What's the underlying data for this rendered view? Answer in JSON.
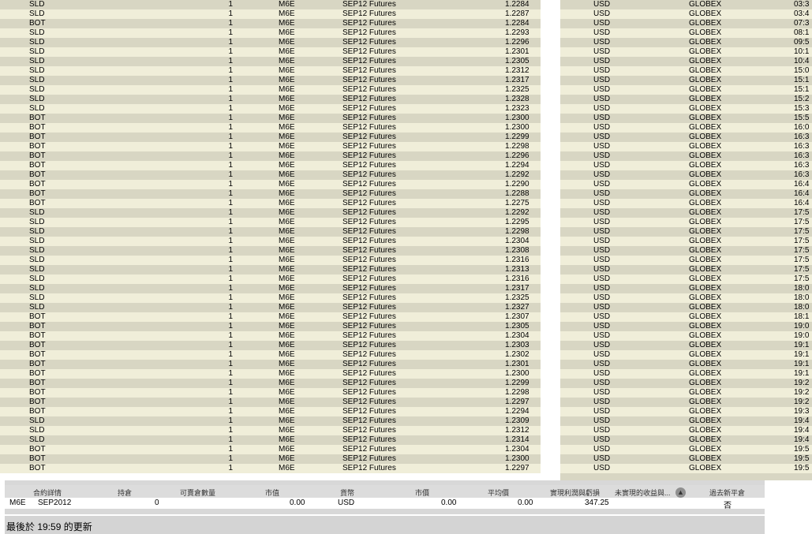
{
  "trades": [
    {
      "action": "SLD",
      "qty": "1",
      "symbol": "M6E",
      "description": "SEP12 Futures",
      "price": "1.2284",
      "currency": "USD",
      "exchange": "GLOBEX",
      "time": "03:3"
    },
    {
      "action": "SLD",
      "qty": "1",
      "symbol": "M6E",
      "description": "SEP12 Futures",
      "price": "1.2287",
      "currency": "USD",
      "exchange": "GLOBEX",
      "time": "03:4"
    },
    {
      "action": "BOT",
      "qty": "1",
      "symbol": "M6E",
      "description": "SEP12 Futures",
      "price": "1.2284",
      "currency": "USD",
      "exchange": "GLOBEX",
      "time": "07:3"
    },
    {
      "action": "SLD",
      "qty": "1",
      "symbol": "M6E",
      "description": "SEP12 Futures",
      "price": "1.2293",
      "currency": "USD",
      "exchange": "GLOBEX",
      "time": "08:1"
    },
    {
      "action": "SLD",
      "qty": "1",
      "symbol": "M6E",
      "description": "SEP12 Futures",
      "price": "1.2296",
      "currency": "USD",
      "exchange": "GLOBEX",
      "time": "09:5"
    },
    {
      "action": "SLD",
      "qty": "1",
      "symbol": "M6E",
      "description": "SEP12 Futures",
      "price": "1.2301",
      "currency": "USD",
      "exchange": "GLOBEX",
      "time": "10:1"
    },
    {
      "action": "SLD",
      "qty": "1",
      "symbol": "M6E",
      "description": "SEP12 Futures",
      "price": "1.2305",
      "currency": "USD",
      "exchange": "GLOBEX",
      "time": "10:4"
    },
    {
      "action": "SLD",
      "qty": "1",
      "symbol": "M6E",
      "description": "SEP12 Futures",
      "price": "1.2312",
      "currency": "USD",
      "exchange": "GLOBEX",
      "time": "15:0"
    },
    {
      "action": "SLD",
      "qty": "1",
      "symbol": "M6E",
      "description": "SEP12 Futures",
      "price": "1.2317",
      "currency": "USD",
      "exchange": "GLOBEX",
      "time": "15:1"
    },
    {
      "action": "SLD",
      "qty": "1",
      "symbol": "M6E",
      "description": "SEP12 Futures",
      "price": "1.2325",
      "currency": "USD",
      "exchange": "GLOBEX",
      "time": "15:1"
    },
    {
      "action": "SLD",
      "qty": "1",
      "symbol": "M6E",
      "description": "SEP12 Futures",
      "price": "1.2328",
      "currency": "USD",
      "exchange": "GLOBEX",
      "time": "15:2"
    },
    {
      "action": "SLD",
      "qty": "1",
      "symbol": "M6E",
      "description": "SEP12 Futures",
      "price": "1.2323",
      "currency": "USD",
      "exchange": "GLOBEX",
      "time": "15:3"
    },
    {
      "action": "BOT",
      "qty": "1",
      "symbol": "M6E",
      "description": "SEP12 Futures",
      "price": "1.2300",
      "currency": "USD",
      "exchange": "GLOBEX",
      "time": "15:5"
    },
    {
      "action": "BOT",
      "qty": "1",
      "symbol": "M6E",
      "description": "SEP12 Futures",
      "price": "1.2300",
      "currency": "USD",
      "exchange": "GLOBEX",
      "time": "16:0"
    },
    {
      "action": "BOT",
      "qty": "1",
      "symbol": "M6E",
      "description": "SEP12 Futures",
      "price": "1.2299",
      "currency": "USD",
      "exchange": "GLOBEX",
      "time": "16:3"
    },
    {
      "action": "BOT",
      "qty": "1",
      "symbol": "M6E",
      "description": "SEP12 Futures",
      "price": "1.2298",
      "currency": "USD",
      "exchange": "GLOBEX",
      "time": "16:3"
    },
    {
      "action": "BOT",
      "qty": "1",
      "symbol": "M6E",
      "description": "SEP12 Futures",
      "price": "1.2296",
      "currency": "USD",
      "exchange": "GLOBEX",
      "time": "16:3"
    },
    {
      "action": "BOT",
      "qty": "1",
      "symbol": "M6E",
      "description": "SEP12 Futures",
      "price": "1.2294",
      "currency": "USD",
      "exchange": "GLOBEX",
      "time": "16:3"
    },
    {
      "action": "BOT",
      "qty": "1",
      "symbol": "M6E",
      "description": "SEP12 Futures",
      "price": "1.2292",
      "currency": "USD",
      "exchange": "GLOBEX",
      "time": "16:3"
    },
    {
      "action": "BOT",
      "qty": "1",
      "symbol": "M6E",
      "description": "SEP12 Futures",
      "price": "1.2290",
      "currency": "USD",
      "exchange": "GLOBEX",
      "time": "16:4"
    },
    {
      "action": "BOT",
      "qty": "1",
      "symbol": "M6E",
      "description": "SEP12 Futures",
      "price": "1.2288",
      "currency": "USD",
      "exchange": "GLOBEX",
      "time": "16:4"
    },
    {
      "action": "BOT",
      "qty": "1",
      "symbol": "M6E",
      "description": "SEP12 Futures",
      "price": "1.2275",
      "currency": "USD",
      "exchange": "GLOBEX",
      "time": "16:4"
    },
    {
      "action": "SLD",
      "qty": "1",
      "symbol": "M6E",
      "description": "SEP12 Futures",
      "price": "1.2292",
      "currency": "USD",
      "exchange": "GLOBEX",
      "time": "17:5"
    },
    {
      "action": "SLD",
      "qty": "1",
      "symbol": "M6E",
      "description": "SEP12 Futures",
      "price": "1.2295",
      "currency": "USD",
      "exchange": "GLOBEX",
      "time": "17:5"
    },
    {
      "action": "SLD",
      "qty": "1",
      "symbol": "M6E",
      "description": "SEP12 Futures",
      "price": "1.2298",
      "currency": "USD",
      "exchange": "GLOBEX",
      "time": "17:5"
    },
    {
      "action": "SLD",
      "qty": "1",
      "symbol": "M6E",
      "description": "SEP12 Futures",
      "price": "1.2304",
      "currency": "USD",
      "exchange": "GLOBEX",
      "time": "17:5"
    },
    {
      "action": "SLD",
      "qty": "1",
      "symbol": "M6E",
      "description": "SEP12 Futures",
      "price": "1.2308",
      "currency": "USD",
      "exchange": "GLOBEX",
      "time": "17:5"
    },
    {
      "action": "SLD",
      "qty": "1",
      "symbol": "M6E",
      "description": "SEP12 Futures",
      "price": "1.2316",
      "currency": "USD",
      "exchange": "GLOBEX",
      "time": "17:5"
    },
    {
      "action": "SLD",
      "qty": "1",
      "symbol": "M6E",
      "description": "SEP12 Futures",
      "price": "1.2313",
      "currency": "USD",
      "exchange": "GLOBEX",
      "time": "17:5"
    },
    {
      "action": "SLD",
      "qty": "1",
      "symbol": "M6E",
      "description": "SEP12 Futures",
      "price": "1.2316",
      "currency": "USD",
      "exchange": "GLOBEX",
      "time": "17:5"
    },
    {
      "action": "SLD",
      "qty": "1",
      "symbol": "M6E",
      "description": "SEP12 Futures",
      "price": "1.2317",
      "currency": "USD",
      "exchange": "GLOBEX",
      "time": "18:0"
    },
    {
      "action": "SLD",
      "qty": "1",
      "symbol": "M6E",
      "description": "SEP12 Futures",
      "price": "1.2325",
      "currency": "USD",
      "exchange": "GLOBEX",
      "time": "18:0"
    },
    {
      "action": "SLD",
      "qty": "1",
      "symbol": "M6E",
      "description": "SEP12 Futures",
      "price": "1.2327",
      "currency": "USD",
      "exchange": "GLOBEX",
      "time": "18:0"
    },
    {
      "action": "BOT",
      "qty": "1",
      "symbol": "M6E",
      "description": "SEP12 Futures",
      "price": "1.2307",
      "currency": "USD",
      "exchange": "GLOBEX",
      "time": "18:1"
    },
    {
      "action": "BOT",
      "qty": "1",
      "symbol": "M6E",
      "description": "SEP12 Futures",
      "price": "1.2305",
      "currency": "USD",
      "exchange": "GLOBEX",
      "time": "19:0"
    },
    {
      "action": "BOT",
      "qty": "1",
      "symbol": "M6E",
      "description": "SEP12 Futures",
      "price": "1.2304",
      "currency": "USD",
      "exchange": "GLOBEX",
      "time": "19:0"
    },
    {
      "action": "BOT",
      "qty": "1",
      "symbol": "M6E",
      "description": "SEP12 Futures",
      "price": "1.2303",
      "currency": "USD",
      "exchange": "GLOBEX",
      "time": "19:1"
    },
    {
      "action": "BOT",
      "qty": "1",
      "symbol": "M6E",
      "description": "SEP12 Futures",
      "price": "1.2302",
      "currency": "USD",
      "exchange": "GLOBEX",
      "time": "19:1"
    },
    {
      "action": "BOT",
      "qty": "1",
      "symbol": "M6E",
      "description": "SEP12 Futures",
      "price": "1.2301",
      "currency": "USD",
      "exchange": "GLOBEX",
      "time": "19:1"
    },
    {
      "action": "BOT",
      "qty": "1",
      "symbol": "M6E",
      "description": "SEP12 Futures",
      "price": "1.2300",
      "currency": "USD",
      "exchange": "GLOBEX",
      "time": "19:1"
    },
    {
      "action": "BOT",
      "qty": "1",
      "symbol": "M6E",
      "description": "SEP12 Futures",
      "price": "1.2299",
      "currency": "USD",
      "exchange": "GLOBEX",
      "time": "19:2"
    },
    {
      "action": "BOT",
      "qty": "1",
      "symbol": "M6E",
      "description": "SEP12 Futures",
      "price": "1.2298",
      "currency": "USD",
      "exchange": "GLOBEX",
      "time": "19:2"
    },
    {
      "action": "BOT",
      "qty": "1",
      "symbol": "M6E",
      "description": "SEP12 Futures",
      "price": "1.2297",
      "currency": "USD",
      "exchange": "GLOBEX",
      "time": "19:2"
    },
    {
      "action": "BOT",
      "qty": "1",
      "symbol": "M6E",
      "description": "SEP12 Futures",
      "price": "1.2294",
      "currency": "USD",
      "exchange": "GLOBEX",
      "time": "19:3"
    },
    {
      "action": "SLD",
      "qty": "1",
      "symbol": "M6E",
      "description": "SEP12 Futures",
      "price": "1.2309",
      "currency": "USD",
      "exchange": "GLOBEX",
      "time": "19:4"
    },
    {
      "action": "SLD",
      "qty": "1",
      "symbol": "M6E",
      "description": "SEP12 Futures",
      "price": "1.2312",
      "currency": "USD",
      "exchange": "GLOBEX",
      "time": "19:4"
    },
    {
      "action": "SLD",
      "qty": "1",
      "symbol": "M6E",
      "description": "SEP12 Futures",
      "price": "1.2314",
      "currency": "USD",
      "exchange": "GLOBEX",
      "time": "19:4"
    },
    {
      "action": "BOT",
      "qty": "1",
      "symbol": "M6E",
      "description": "SEP12 Futures",
      "price": "1.2304",
      "currency": "USD",
      "exchange": "GLOBEX",
      "time": "19:5"
    },
    {
      "action": "BOT",
      "qty": "1",
      "symbol": "M6E",
      "description": "SEP12 Futures",
      "price": "1.2300",
      "currency": "USD",
      "exchange": "GLOBEX",
      "time": "19:5"
    },
    {
      "action": "BOT",
      "qty": "1",
      "symbol": "M6E",
      "description": "SEP12 Futures",
      "price": "1.2297",
      "currency": "USD",
      "exchange": "GLOBEX",
      "time": "19:5"
    }
  ],
  "portfolio": {
    "headers": {
      "contract": "合約詳情",
      "position": "持倉",
      "available_qty": "可賣倉數量",
      "market_value": "市值",
      "currency": "貨幣",
      "market_price": "市價",
      "avg_price": "平均價",
      "realized_pnl": "實現利潤與虧損",
      "unrealized_pnl": "未實現的收益與...",
      "close_out": "過去新平倉"
    },
    "row": {
      "symbol": "M6E",
      "expiry": "SEP2012",
      "position": "0",
      "market_value": "0.00",
      "currency": "USD",
      "market_price": "0.00",
      "avg_price": "0.00",
      "realized_pnl": "347.25",
      "close_out": "否"
    },
    "sort_icon": "up-arrow-circle-icon"
  },
  "status": {
    "text": "最後於 19:59 的更新"
  }
}
